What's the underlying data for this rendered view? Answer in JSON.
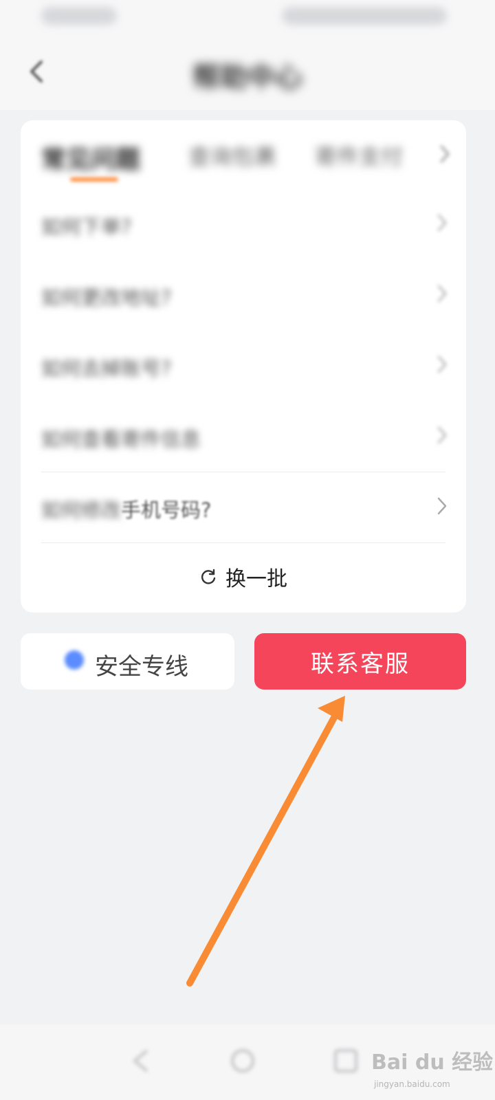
{
  "status_bar": {
    "left_text": "",
    "right_text": ""
  },
  "header": {
    "title": "帮助中心",
    "back_icon": "chevron-left-icon"
  },
  "tabs": [
    {
      "label": "常见问题",
      "active": true
    },
    {
      "label": "查询包裹",
      "active": false
    },
    {
      "label": "寄件支付",
      "active": false
    }
  ],
  "faq": {
    "items": [
      {
        "question": "如何下单?"
      },
      {
        "question": "如何更改地址?"
      },
      {
        "question": "如何去掉账号?"
      },
      {
        "question": "如何查看寄件信息"
      },
      {
        "question_blur": "如何修改",
        "question_clear": "手机号码?"
      }
    ],
    "refresh_label": "换一批",
    "refresh_icon": "refresh-icon"
  },
  "buttons": {
    "secure_line": "安全专线",
    "contact_service": "联系客服"
  },
  "colors": {
    "contact_button": "#f5455a",
    "arrow": "#f98b35",
    "tab_underline": "#ff8a3a"
  },
  "watermark": {
    "text": "Bai du 经验",
    "sub": "jingyan.baidu.com"
  }
}
